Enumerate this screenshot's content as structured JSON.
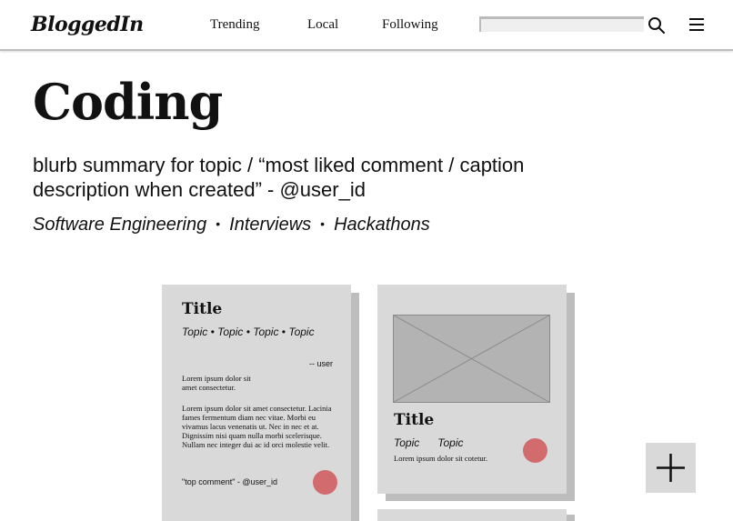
{
  "header": {
    "logo": "BloggedIn",
    "nav": [
      "Trending",
      "Local",
      "Following"
    ],
    "search": {
      "value": "",
      "placeholder": ""
    }
  },
  "topic": {
    "title": "Coding",
    "blurb": "blurb summary for topic / “most liked comment / caption description when created” - @user_id",
    "tags": [
      "Software Engineering",
      "Interviews",
      "Hackathons"
    ],
    "tag_separator": "•"
  },
  "cards": [
    {
      "title": "Title",
      "topics": "Topic  •  Topic  •  Topic  •  Topic",
      "user": "-- user",
      "excerpt": "Lorem ipsum dolor sit amet consectetur.",
      "body": "Lorem ipsum dolor sit amet consectetur. Lacinia fames fermentum diam nec vitae. Morbi eu vivamus lacus venenatis ut. Nec in nec et at. Dignissim nisi quam nulla morbi scelerisque. Nullam nec integer dui ac id orci molestie velit.",
      "top_comment": "\"top comment\" - @user_id"
    },
    {
      "title": "Title",
      "topics": "Topic      Topic",
      "excerpt": "Lorem ipsum dolor sit cotetur.",
      "image": "image-placeholder"
    }
  ],
  "icons": {
    "search": "search-icon",
    "menu": "hamburger-menu-icon",
    "add": "plus-icon"
  },
  "colors": {
    "card_bg": "#d9d9d9",
    "card_shadow": "#bdbdbd",
    "like": "#d26b6e",
    "placeholder": "#b3b3b3"
  }
}
